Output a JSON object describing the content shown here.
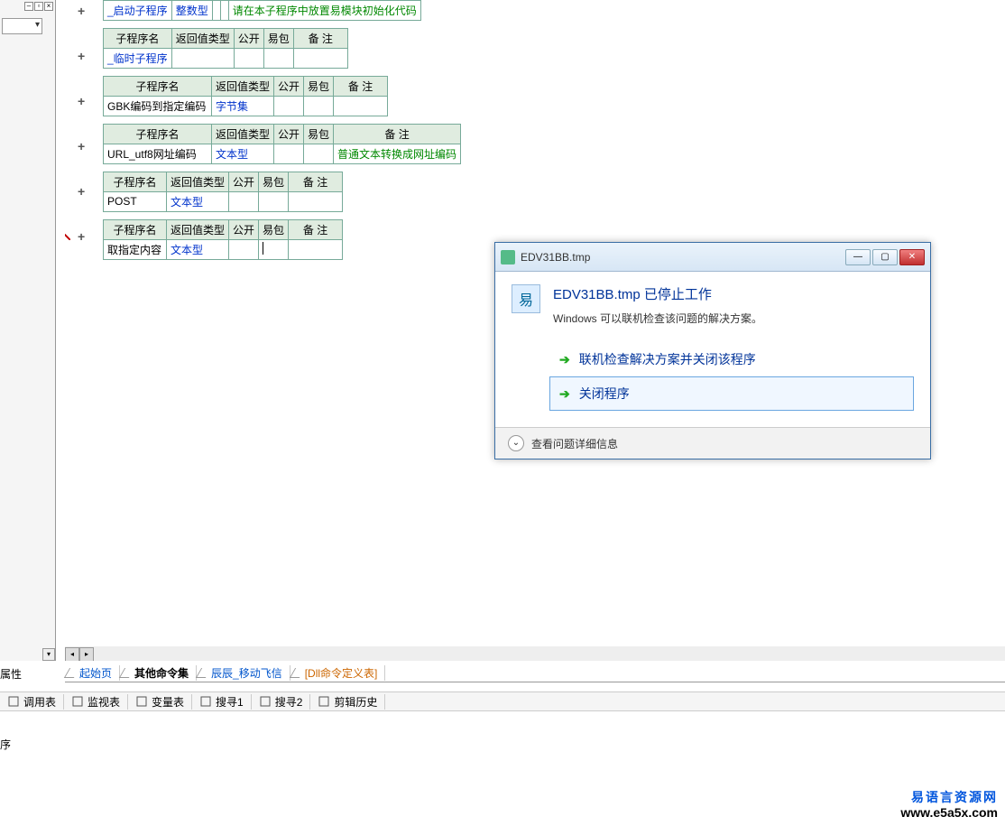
{
  "left_panel": {
    "prop_label": "属性"
  },
  "headers": {
    "name": "子程序名",
    "return": "返回值类型",
    "public": "公开",
    "pkg": "易包",
    "remark": "备 注"
  },
  "subs": [
    {
      "name": "_启动子程序",
      "return": "整数型",
      "public": "",
      "pkg": "",
      "remark": "请在本子程序中放置易模块初始化代码",
      "name_cls": "blue",
      "ret_cls": "blue",
      "rem_cls": "green",
      "header": false
    },
    {
      "name": "_临时子程序",
      "return": "",
      "public": "",
      "pkg": "",
      "remark": "",
      "name_cls": "blue",
      "header": true
    },
    {
      "name": "GBK编码到指定编码",
      "return": "字节集",
      "public": "",
      "pkg": "",
      "remark": "",
      "ret_cls": "blue",
      "header": true,
      "wide_name": true
    },
    {
      "name": "URL_utf8网址编码",
      "return": "文本型",
      "public": "",
      "pkg": "",
      "remark": "普通文本转换成网址编码",
      "ret_cls": "blue",
      "rem_cls": "green",
      "header": true,
      "wide_name": true
    },
    {
      "name": "POST",
      "return": "文本型",
      "public": "",
      "pkg": "",
      "remark": "",
      "ret_cls": "blue",
      "header": true
    },
    {
      "name": "取指定内容",
      "return": "文本型",
      "public": "",
      "pkg": "",
      "remark": "",
      "ret_cls": "blue",
      "header": true,
      "cursor": true
    }
  ],
  "tabs": [
    {
      "label": "起始页",
      "cls": ""
    },
    {
      "label": "其他命令集",
      "cls": "active"
    },
    {
      "label": "辰辰_移动飞信",
      "cls": ""
    },
    {
      "label": "[Dll命令定义表]",
      "cls": "orange"
    }
  ],
  "toolbar": [
    {
      "label": "调用表",
      "icon": "list"
    },
    {
      "label": "监视表",
      "icon": "search"
    },
    {
      "label": "变量表",
      "icon": "var"
    },
    {
      "label": "搜寻1",
      "icon": "find"
    },
    {
      "label": "搜寻2",
      "icon": "find"
    },
    {
      "label": "剪辑历史",
      "icon": "clip"
    }
  ],
  "status": "序",
  "dialog": {
    "title": "EDV31BB.tmp",
    "heading": "EDV31BB.tmp 已停止工作",
    "subtext": "Windows 可以联机检查该问题的解决方案。",
    "opt1": "联机检查解决方案并关闭该程序",
    "opt2": "关闭程序",
    "details": "查看问题详细信息"
  },
  "watermark": {
    "cn": "易语言资源网",
    "en": "www.e5a5x.com"
  }
}
